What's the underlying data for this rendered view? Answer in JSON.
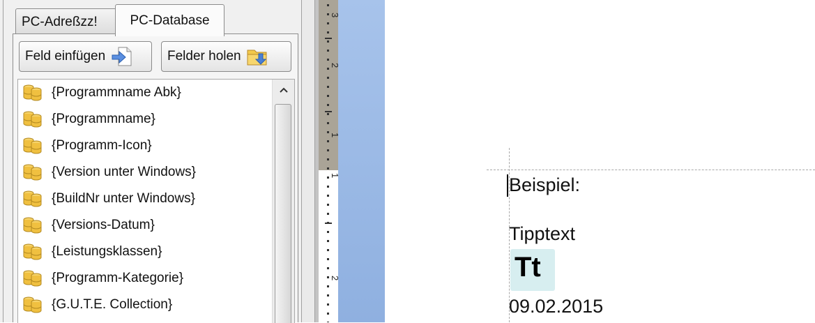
{
  "tabs": [
    {
      "label": "PC-Adreßzz!",
      "active": false
    },
    {
      "label": "PC-Database",
      "active": true
    }
  ],
  "toolbar": {
    "insert_field_label": "Feld einfügen",
    "fetch_fields_label": "Felder holen"
  },
  "field_list": {
    "items": [
      "{Programmname Abk}",
      "{Programmname}",
      "{Programm-Icon}",
      "{Version unter Windows}",
      "{BuildNr unter Windows}",
      "{Versions-Datum}",
      "{Leistungsklassen}",
      "{Programm-Kategorie}",
      "{G.U.T.E. Collection}"
    ]
  },
  "ruler": {
    "labels": [
      "3",
      "2",
      "1",
      "1",
      "2"
    ]
  },
  "document": {
    "heading": "Beispiel:",
    "tip_label": "Tipptext",
    "icon_text": "Tt",
    "date": "09.02.2015"
  },
  "colors": {
    "desk_blue": "#9ab9e6",
    "tt_background": "#d7eef0",
    "ruler_margin": "#aaa497"
  }
}
